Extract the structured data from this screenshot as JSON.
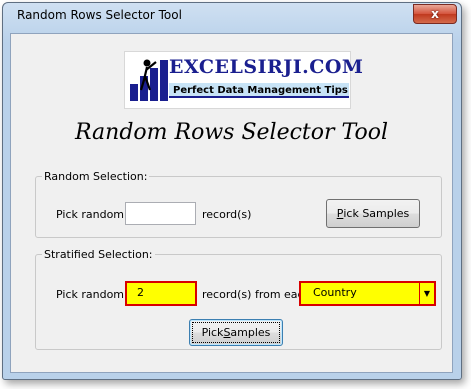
{
  "window": {
    "title": "Random Rows Selector Tool",
    "close_glyph": "x"
  },
  "logo": {
    "brand": "EXCELSIRJI.COM",
    "tagline": "Perfect Data Management Tips"
  },
  "heading": "Random Rows Selector Tool",
  "random_selection": {
    "legend": "Random Selection:",
    "pick_label": "Pick randomly",
    "count_value": "",
    "records_label": "record(s)",
    "button_label_first": "P",
    "button_label_rest": "ick Samples"
  },
  "stratified_selection": {
    "legend": "Stratified Selection:",
    "pick_label": "Pick randomly",
    "count_value": "2",
    "records_label": "record(s) from each",
    "group_by_value": "Country",
    "button_label_first": "Pick ",
    "button_label_u": "S",
    "button_label_rest": "amples"
  },
  "colors": {
    "highlight": "#ffff00",
    "highlight_border": "#d80000",
    "brand": "#1a1f8f"
  },
  "icons": {
    "close": "close-icon",
    "dropdown": "chevron-down-icon",
    "logo_figure": "presenter-chart-icon"
  }
}
